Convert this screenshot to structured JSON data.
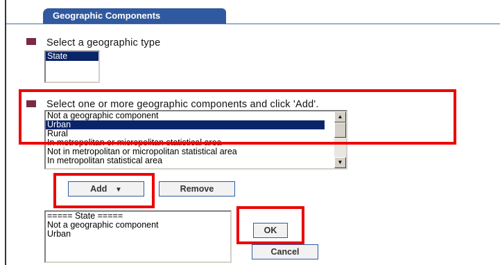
{
  "tab": {
    "label": "Geographic Components"
  },
  "type_section": {
    "label": "Select a geographic type",
    "options": [
      {
        "label": "State",
        "selected": true
      }
    ]
  },
  "components_section": {
    "label": "Select one or more geographic components and click 'Add'.",
    "options": [
      {
        "label": "Not a geographic component",
        "selected": false
      },
      {
        "label": "Urban",
        "selected": true
      },
      {
        "label": "Rural",
        "selected": false
      },
      {
        "label": "In metropolitan or micropolitan statistical area",
        "selected": false
      },
      {
        "label": "Not in metropolitan or micropolitan statistical area",
        "selected": false
      },
      {
        "label": "In metropolitan statistical area",
        "selected": false
      }
    ]
  },
  "buttons": {
    "add": "Add",
    "remove": "Remove",
    "ok": "OK",
    "cancel": "Cancel"
  },
  "selected_list": {
    "items": [
      "===== State =====",
      "Not a geographic component",
      "Urban"
    ]
  },
  "colors": {
    "tab_blue": "#31599f",
    "bullet": "#7a2b43",
    "highlight": "#0a246a",
    "annotation_red": "#ee0000"
  }
}
